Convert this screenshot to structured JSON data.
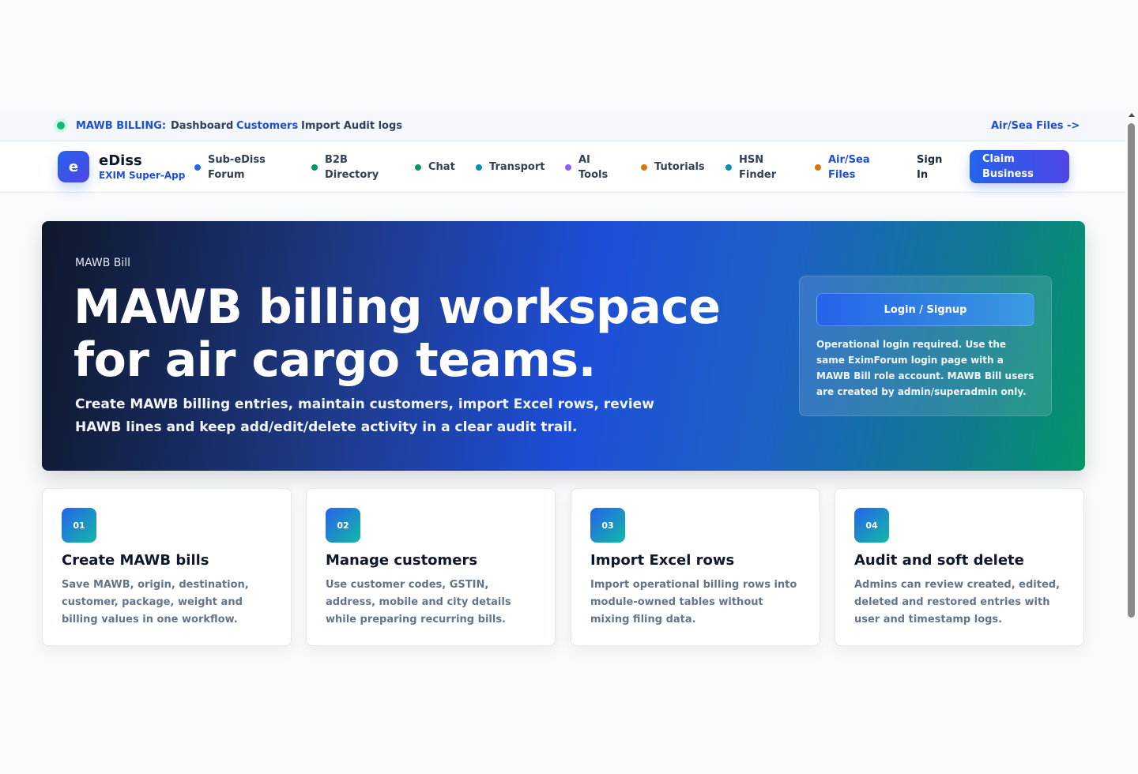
{
  "topbar": {
    "title": "MAWB BILLING:",
    "links": [
      "Dashboard",
      "Customers",
      "Import Audit logs"
    ],
    "right_link": "Air/Sea Files ->"
  },
  "brand": {
    "logo_letter": "e",
    "name": "eDiss",
    "tagline": "EXIM Super-App"
  },
  "nav": {
    "items": [
      {
        "label": "Sub-eDiss Forum",
        "dot_color": "#2563eb"
      },
      {
        "label": "B2B Directory",
        "dot_color": "#059669"
      },
      {
        "label": "Chat",
        "dot_color": "#059669"
      },
      {
        "label": "Transport",
        "dot_color": "#0891b2"
      },
      {
        "label": "AI Tools",
        "dot_color": "#8b5cf6"
      },
      {
        "label": "Tutorials",
        "dot_color": "#d97706"
      },
      {
        "label": "HSN Finder",
        "dot_color": "#0891b2"
      },
      {
        "label": "Air/Sea Files",
        "dot_color": "#d97706",
        "color": "#1d4ed8"
      }
    ],
    "sign_in": "Sign In",
    "claim_button": "Claim Business"
  },
  "hero": {
    "eyebrow": "MAWB Bill",
    "heading": "MAWB billing workspace for air cargo teams.",
    "lead": "Create MAWB billing entries, maintain customers, import Excel rows, review HAWB lines and keep add/edit/delete activity in a clear audit trail.",
    "login_button": "Login / Signup",
    "login_note": "Operational login required. Use the same EximForum login page with a MAWB Bill role account. MAWB Bill users are created by admin/superadmin only."
  },
  "features": [
    {
      "num": "01",
      "title": "Create MAWB bills",
      "desc": "Save MAWB, origin, destination, customer, package, weight and billing values in one workflow."
    },
    {
      "num": "02",
      "title": "Manage customers",
      "desc": "Use customer codes, GSTIN, address, mobile and city details while preparing recurring bills."
    },
    {
      "num": "03",
      "title": "Import Excel rows",
      "desc": "Import operational billing rows into module-owned tables without mixing filing data."
    },
    {
      "num": "04",
      "title": "Audit and soft delete",
      "desc": "Admins can review created, edited, deleted and restored entries with user and timestamp logs."
    }
  ]
}
